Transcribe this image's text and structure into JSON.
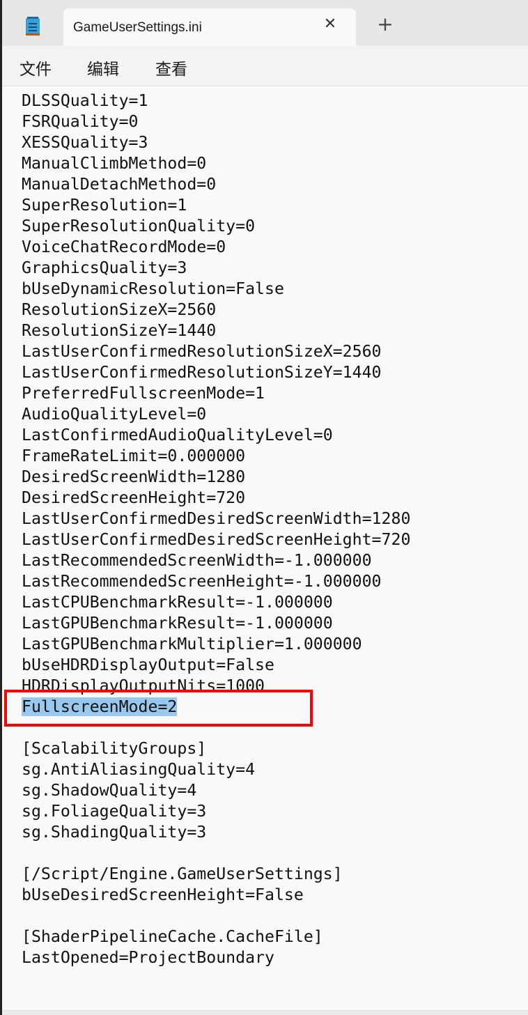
{
  "tab": {
    "title": "GameUserSettings.ini",
    "close_icon": "close-icon",
    "new_tab_icon": "plus-icon"
  },
  "menu": {
    "items": [
      "文件",
      "编辑",
      "查看"
    ]
  },
  "editor": {
    "lines": [
      "",
      "DLSSQuality=1",
      "FSRQuality=0",
      "XESSQuality=3",
      "ManualClimbMethod=0",
      "ManualDetachMethod=0",
      "SuperResolution=1",
      "SuperResolutionQuality=0",
      "VoiceChatRecordMode=0",
      "GraphicsQuality=3",
      "bUseDynamicResolution=False",
      "ResolutionSizeX=2560",
      "ResolutionSizeY=1440",
      "LastUserConfirmedResolutionSizeX=2560",
      "LastUserConfirmedResolutionSizeY=1440",
      "PreferredFullscreenMode=1",
      "AudioQualityLevel=0",
      "LastConfirmedAudioQualityLevel=0",
      "FrameRateLimit=0.000000",
      "DesiredScreenWidth=1280",
      "DesiredScreenHeight=720",
      "LastUserConfirmedDesiredScreenWidth=1280",
      "LastUserConfirmedDesiredScreenHeight=720",
      "LastRecommendedScreenWidth=-1.000000",
      "LastRecommendedScreenHeight=-1.000000",
      "LastCPUBenchmarkResult=-1.000000",
      "LastGPUBenchmarkResult=-1.000000",
      "LastGPUBenchmarkMultiplier=1.000000",
      "bUseHDRDisplayOutput=False",
      "HDRDisplayOutputNits=1000",
      "FullscreenMode=2",
      "",
      "[ScalabilityGroups]",
      "sg.AntiAliasingQuality=4",
      "sg.ShadowQuality=4",
      "sg.FoliageQuality=3",
      "sg.ShadingQuality=3",
      "",
      "[/Script/Engine.GameUserSettings]",
      "bUseDesiredScreenHeight=False",
      "",
      "[ShaderPipelineCache.CacheFile]",
      "LastOpened=ProjectBoundary"
    ],
    "selected_line": 30,
    "selection_color": "#99c8ee",
    "highlight_box_color": "#ff0000"
  }
}
